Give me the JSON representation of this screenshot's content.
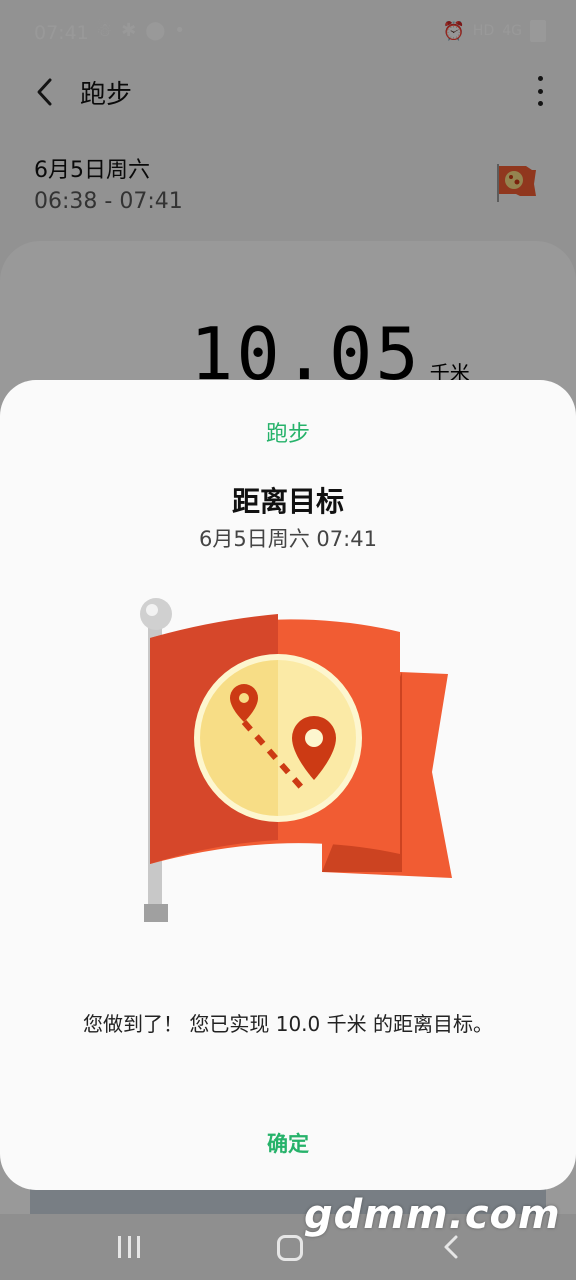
{
  "status_bar": {
    "time": "07:41",
    "left_icons": [
      "app-notification-icon",
      "bug-notification-icon",
      "location-icon",
      "dot-icon"
    ],
    "right_icons": [
      "alarm-icon",
      "hd-icon",
      "4g-signal-icon",
      "battery-icon"
    ],
    "hd_label": "HD",
    "network_label": "4G"
  },
  "header": {
    "title": "跑步",
    "back_icon": "chevron-left-icon",
    "menu_icon": "more-vertical-icon"
  },
  "workout": {
    "date": "6月5日周六",
    "time_range": "06:38 - 07:41",
    "distance_value": "10.05",
    "distance_unit": "千米"
  },
  "dialog": {
    "category": "跑步",
    "title": "距离目标",
    "date_time": "6月5日周六 07:41",
    "badge_icon": "goal-flag-icon",
    "message": "您做到了！ 您已实现 10.0 千米 的距离目标。",
    "confirm_label": "确定"
  },
  "nav_bar": {
    "recents_icon": "recents-icon",
    "home_icon": "home-icon",
    "back_icon": "back-icon"
  },
  "watermark": "gdmm.com",
  "colors": {
    "accent": "#26b26a",
    "flag_red": "#f15c33",
    "flag_dark": "#d6472a",
    "badge_yellow": "#f7dd86",
    "pin_red": "#cc3a14"
  }
}
